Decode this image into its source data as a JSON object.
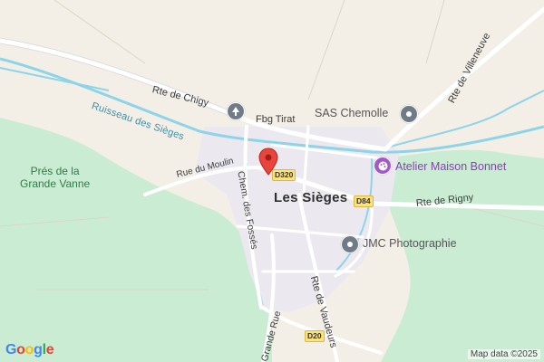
{
  "map": {
    "town": "Les Sièges",
    "water": [
      "Ruisseau des Sièges"
    ],
    "area": "Prés de la\nGrande Vanne",
    "roads": {
      "chigy": "Rte de Chigy",
      "tirat": "Fbg Tirat",
      "moulin": "Rue du Moulin",
      "fosses": "Chem. des Fossés",
      "vaudeurs": "Rte de Vaudeurs",
      "grande_rue": "Grande Rue",
      "rigny": "Rte de Rigny",
      "villeneuve": "Rte de Villeneuve"
    },
    "shields": {
      "d320": "D320",
      "d84": "D84",
      "d20": "D20"
    },
    "pois": [
      {
        "name": "SAS Chemolle",
        "icon": "pin-circle-icon",
        "color": "#6f7c88"
      },
      {
        "name": "Atelier Maison Bonnet",
        "icon": "palette-icon",
        "color": "#a259c9"
      },
      {
        "name": "JMC Photographie",
        "icon": "camera-pin-icon",
        "color": "#6f7c88"
      }
    ],
    "marker": {
      "icon": "map-pin-icon",
      "color": "#e8453c"
    },
    "branding": {
      "logo": "Google",
      "attribution": "Map data ©2025"
    },
    "colors": {
      "land": "#f3efe6",
      "park": "#c9ecd3",
      "water": "#8dd4e8",
      "road": "#ffffff",
      "urban": "#ebe9ef"
    }
  }
}
